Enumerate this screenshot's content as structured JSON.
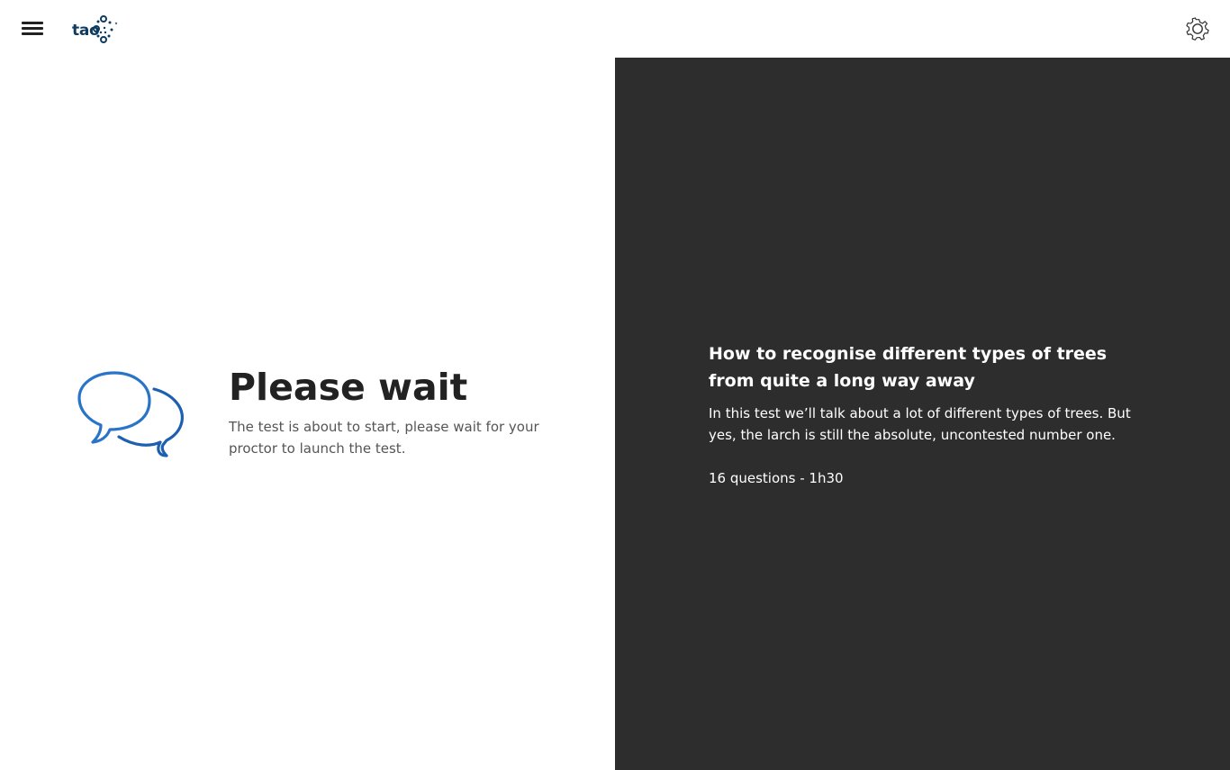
{
  "header": {
    "menu_icon": "hamburger-menu-icon",
    "logo_text": "tao",
    "logo_color": "#0f3b5f",
    "settings_icon": "gear-icon"
  },
  "waiting": {
    "icon": "speech-bubbles-icon",
    "title": "Please wait",
    "message": "The test is about to start, please wait for your proctor to launch the test."
  },
  "test_info": {
    "title": "How to recognise different types of trees from quite a long way away",
    "description": "In this test we’ll talk about a lot of different types of trees. But yes, the larch is still the absolute, uncontested number one.",
    "meta": "16 questions - 1h30"
  },
  "colors": {
    "panel_background": "#2d2d2d",
    "icon_blue": "#2a74c8",
    "text_dark": "#222222",
    "text_muted": "#555555"
  }
}
